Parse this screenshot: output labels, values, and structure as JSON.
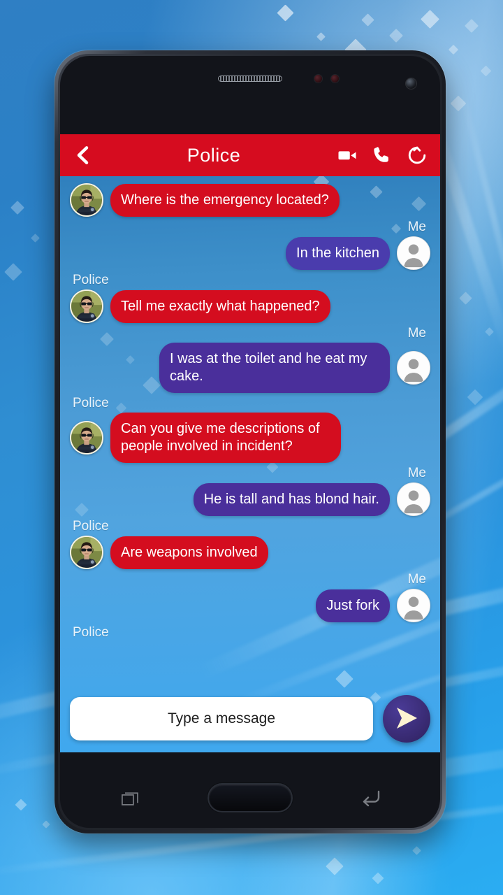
{
  "wallpaper": {
    "color_top": "#2f7fc4",
    "color_bottom": "#2badf2"
  },
  "device": {
    "frame_color": "#1b1e25",
    "nav": {
      "recents_icon": "recents-icon",
      "home_button": "home-button",
      "back_icon": "back-icon"
    },
    "top": {
      "speaker_grille": "speaker-grille",
      "proximity_sensor": "proximity-sensor-icon",
      "light_sensor": "light-sensor-icon",
      "front_camera": "front-camera-icon"
    }
  },
  "app": {
    "accent_red": "#d40d1f",
    "accent_purple": "#4a2f9b",
    "appbar": {
      "back_icon": "chevron-left-icon",
      "title": "Police",
      "video_call_icon": "video-camera-icon",
      "voice_call_icon": "phone-icon",
      "restart_icon": "refresh-icon"
    },
    "chat": {
      "sender_police": "Police",
      "sender_me": "Me",
      "messages": [
        {
          "sender": "",
          "side": "left",
          "text": "Where is the emergency located?",
          "color": "red"
        },
        {
          "sender": "Me",
          "side": "right",
          "text": "In the kitchen",
          "color": "purple-alt"
        },
        {
          "sender": "Police",
          "side": "left",
          "text": "Tell me exactly what happened?",
          "color": "red"
        },
        {
          "sender": "Me",
          "side": "right",
          "text": "I was at the toilet and he eat my cake.",
          "color": "purple"
        },
        {
          "sender": "Police",
          "side": "left",
          "text": "Can you give me descriptions of people involved in incident?",
          "color": "red"
        },
        {
          "sender": "Me",
          "side": "right",
          "text": "He is tall and has blond hair.",
          "color": "purple"
        },
        {
          "sender": "Police",
          "side": "left",
          "text": "Are weapons involved",
          "color": "red"
        },
        {
          "sender": "Me",
          "side": "right",
          "text": "Just fork",
          "color": "purple"
        },
        {
          "sender": "Police",
          "side": "left",
          "text": "",
          "color": "none"
        }
      ]
    },
    "composer": {
      "input_value": "",
      "input_placeholder": "Type a message",
      "send_icon": "send-arrow-icon",
      "send_label": "Send"
    }
  }
}
